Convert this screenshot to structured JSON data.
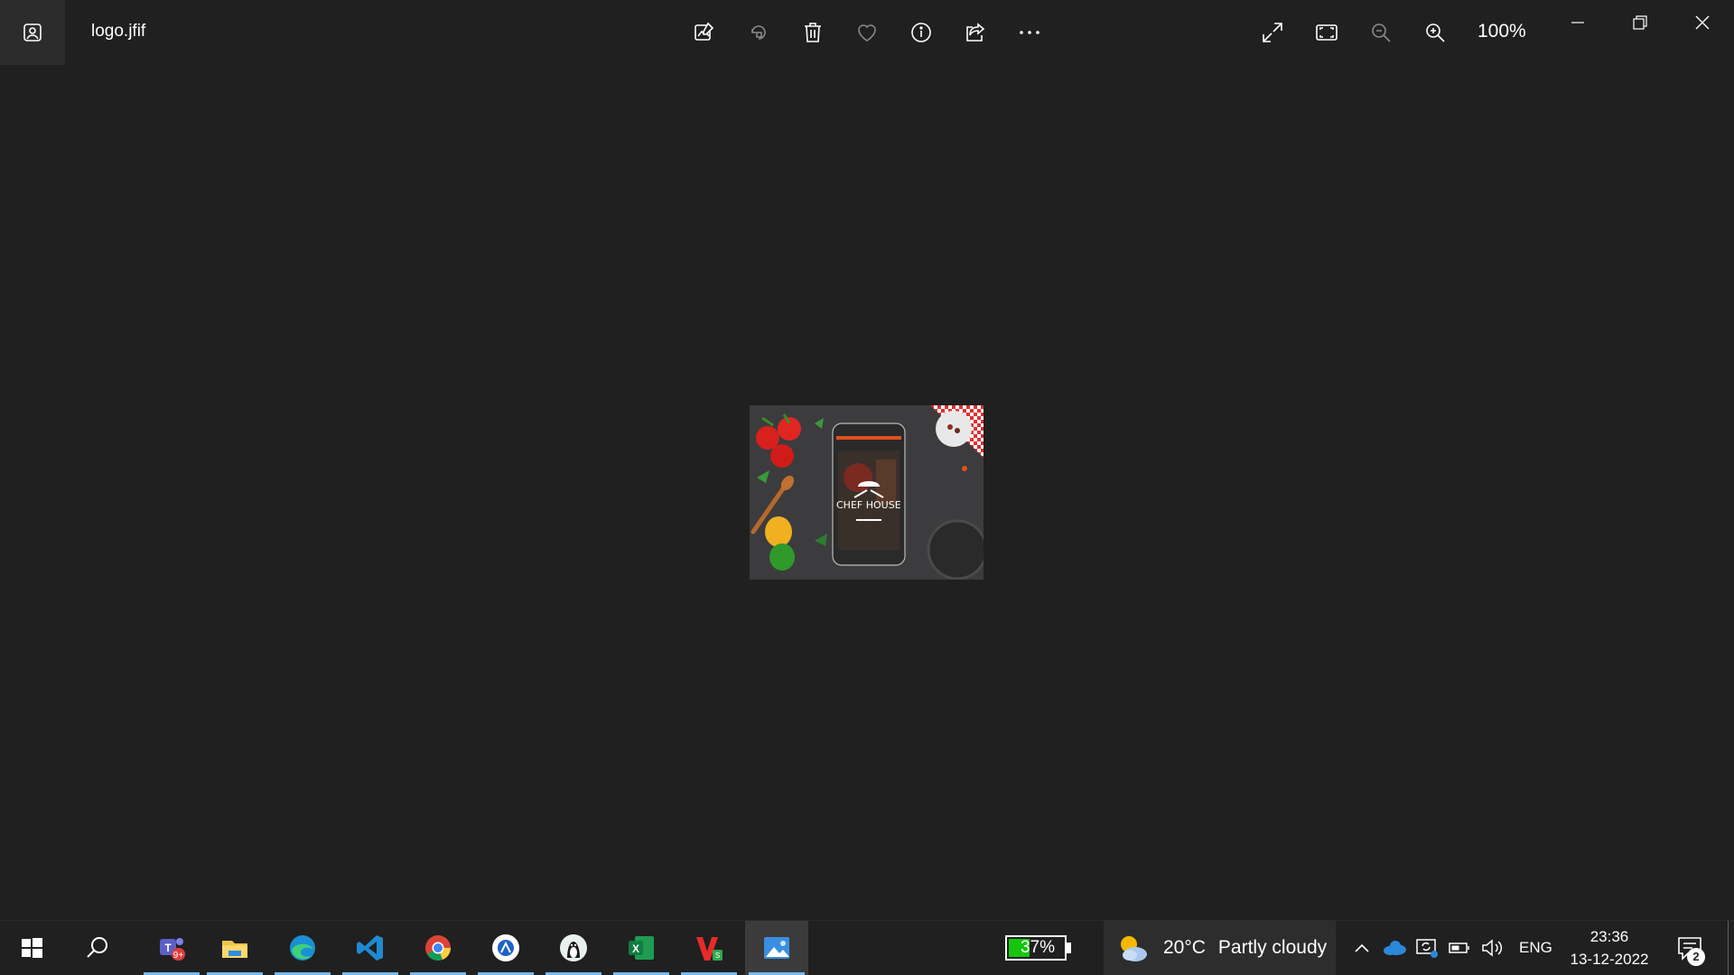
{
  "window": {
    "file_name": "logo.jfif",
    "zoom_level": "100%",
    "toolbar_icons": [
      "edit-image-icon",
      "rotate-icon",
      "delete-icon",
      "favorite-icon",
      "info-icon",
      "share-icon",
      "more-icon"
    ],
    "view_icons": [
      "fullscreen-icon",
      "fit-to-window-icon",
      "zoom-out-icon",
      "zoom-in-icon"
    ],
    "window_controls": [
      "minimize-icon",
      "restore-icon",
      "close-icon"
    ]
  },
  "photo": {
    "brand_text": "CHEF HOUSE"
  },
  "taskbar": {
    "apps": [
      {
        "name": "Microsoft Teams",
        "icon": "teams-icon",
        "badge": "9+",
        "running": true
      },
      {
        "name": "File Explorer",
        "icon": "folder-icon",
        "running": true
      },
      {
        "name": "Microsoft Edge",
        "icon": "edge-icon",
        "running": true
      },
      {
        "name": "Visual Studio Code",
        "icon": "vscode-icon",
        "running": true
      },
      {
        "name": "Google Chrome",
        "icon": "chrome-icon",
        "running": true
      },
      {
        "name": "App",
        "icon": "app-circle-icon",
        "running": true
      },
      {
        "name": "App",
        "icon": "penguin-icon",
        "running": true
      },
      {
        "name": "Excel",
        "icon": "excel-icon",
        "running": true
      },
      {
        "name": "WPS Office",
        "icon": "wps-icon",
        "running": true
      },
      {
        "name": "Photos",
        "icon": "photos-icon",
        "running": true,
        "active": true
      }
    ],
    "battery": "37%",
    "weather": {
      "temperature": "20°C",
      "description": "Partly cloudy"
    },
    "language": "ENG",
    "time": "23:36",
    "date": "13-12-2022",
    "notification_count": "2",
    "colors": {
      "accent": "#76b9ed",
      "battery_fill": "#16c60c",
      "background": "#202020"
    }
  }
}
